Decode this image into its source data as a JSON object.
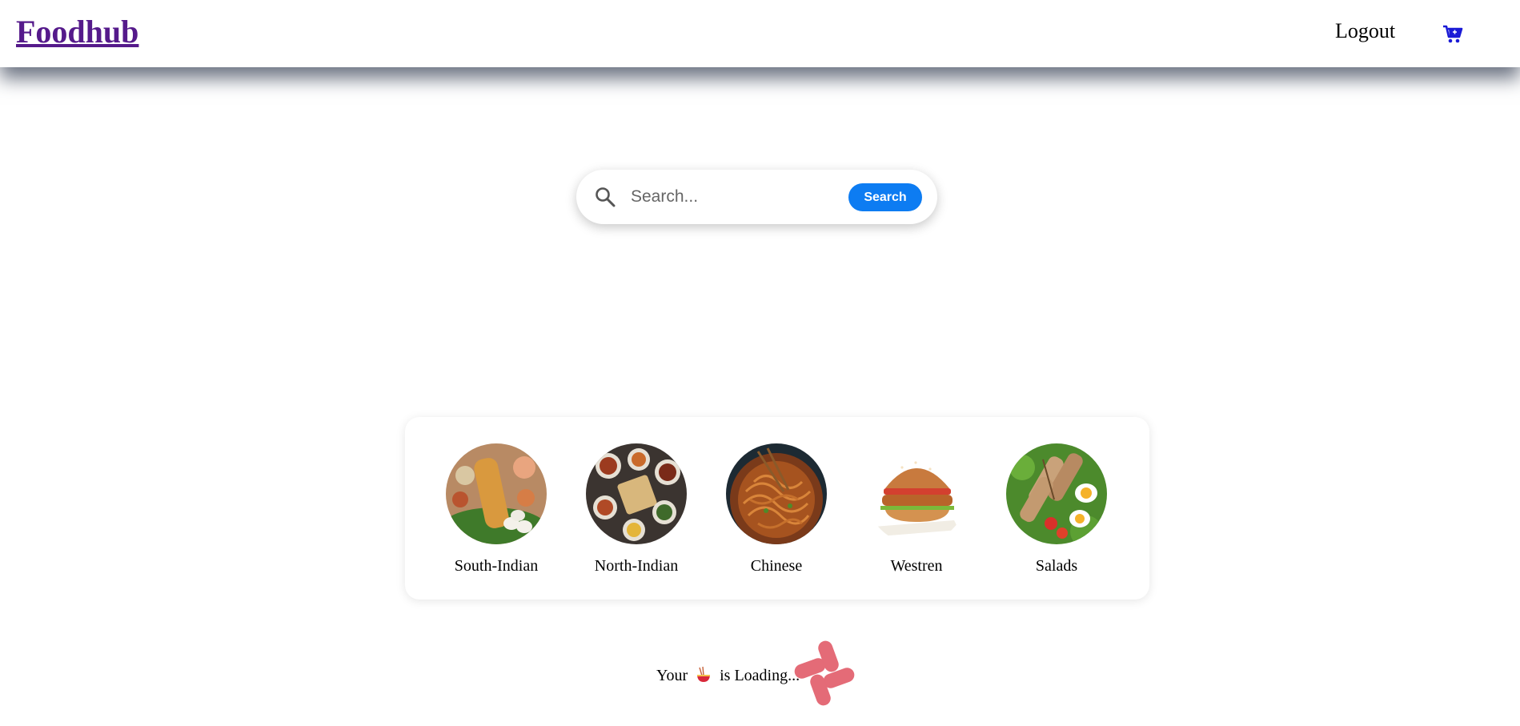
{
  "header": {
    "brand": "Foodhub",
    "logout_label": "Logout",
    "cart_icon": "cart-icon",
    "brand_color": "#551a8b",
    "cart_color": "#1a1ad6"
  },
  "search": {
    "placeholder": "Search...",
    "value": "",
    "button_label": "Search",
    "button_color": "#0d7cf2"
  },
  "categories": [
    {
      "label": "South-Indian",
      "icon": "south-indian-food-image"
    },
    {
      "label": "North-Indian",
      "icon": "north-indian-food-image"
    },
    {
      "label": "Chinese",
      "icon": "chinese-food-image"
    },
    {
      "label": "Westren",
      "icon": "burger-image"
    },
    {
      "label": "Salads",
      "icon": "salad-image"
    }
  ],
  "loading": {
    "prefix": "Your",
    "suffix": "is Loading...",
    "bowl_icon": "noodle-bowl-icon",
    "spinner_icon": "loading-spinner-icon",
    "spinner_color": "#e46b77"
  }
}
